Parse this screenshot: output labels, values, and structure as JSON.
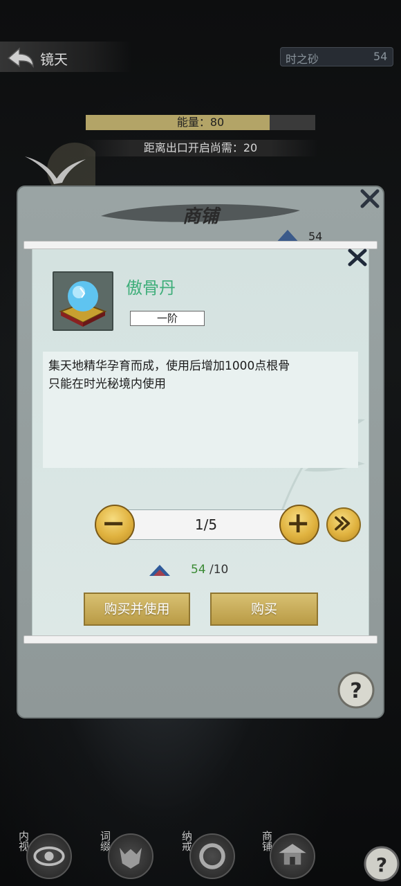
{
  "header": {
    "title": "镜天",
    "resource_name": "时之砂",
    "resource_value": "54"
  },
  "energy": {
    "label": "能量：80",
    "fill_fraction": 0.8
  },
  "exit": {
    "label": "距离出口开启尚需：20"
  },
  "shop": {
    "title": "商铺",
    "currency_value": "54"
  },
  "dialog": {
    "item_name": "傲骨丹",
    "grade": "一阶",
    "description": [
      "集天地精华孕育而成，使用后增加1000点根骨",
      "只能在时光秘境内使用"
    ],
    "quantity": "1/5",
    "cost_have": "54",
    "cost_need": "/10",
    "buy_use_label": "购买并使用",
    "buy_label": "购买"
  },
  "bottom_nav": [
    {
      "label": "内视",
      "icon": "eye-icon"
    },
    {
      "label": "词缀",
      "icon": "beast-mask-icon"
    },
    {
      "label": "纳戒",
      "icon": "ring-icon"
    },
    {
      "label": "商铺",
      "icon": "pavilion-icon"
    }
  ],
  "colors": {
    "item_name": "#3fae7a",
    "cost_have": "#3a8a34",
    "gold_button": "#c9ad59",
    "energy_fill": "#b3a467"
  }
}
